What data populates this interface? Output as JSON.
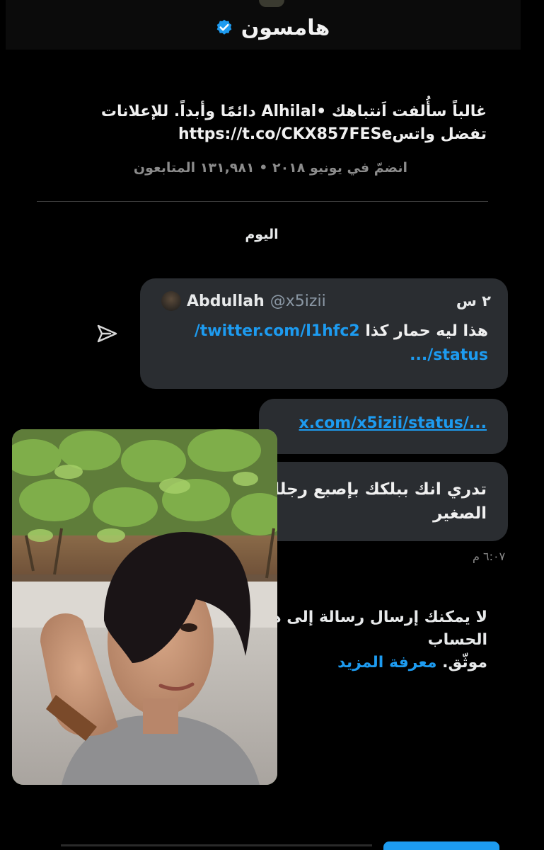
{
  "header": {
    "name": "هامسون",
    "verified_icon": "verified-badge-icon",
    "accent": "#1d9bf0"
  },
  "profile": {
    "bio_line1": "غالباً سأُلفت اَنتباهك •Alhilal دائمًا وأبداً. للإعلانات",
    "bio_line2": "تفضل واتسhttps://t.co/CKX857FESe",
    "joined": "انضمّ في يونيو ٢٠١٨ • ١٣١,٩٨١ المتابعون"
  },
  "conversation": {
    "day_label": "اليوم",
    "quoted_tweet": {
      "author": "Abdullah",
      "handle": "@x5izii",
      "time": "٢ س",
      "text": "هذا ليه حمار كذا",
      "link": "twitter.com/l1hfc2/",
      "link_cont": "status/..."
    },
    "link_message": "x.com/x5izii/status/...",
    "text_message_line1": "تدري انك ببلكك بإصبع رجلك",
    "text_message_line2": "الصغير",
    "message_time": "٦:٠٧ م",
    "notice_line1": "لا يمكنك إرسال رسالة إلى هذا الحساب",
    "notice_line2": "موثّق.",
    "notice_link": "معرفة المزيد"
  },
  "icons": {
    "share": "send-arrow-icon",
    "photo": "selfie-photo"
  }
}
